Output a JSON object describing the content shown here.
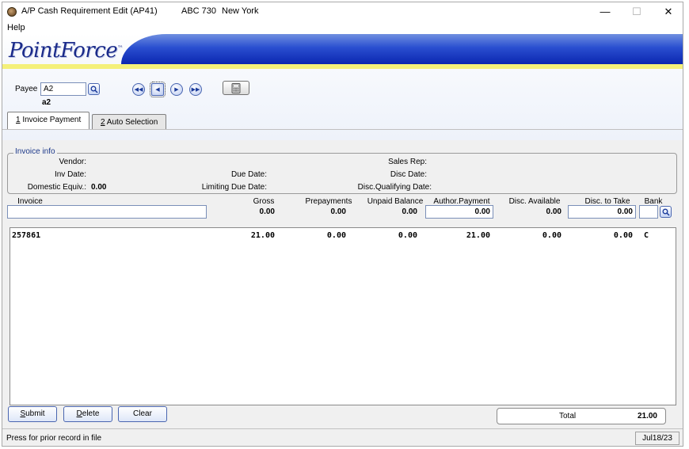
{
  "window": {
    "title": "A/P Cash Requirement Edit (AP41)",
    "company": "ABC 730",
    "city": "New York",
    "controls": {
      "minimize": "—",
      "maximize": "☐",
      "close": "✕"
    }
  },
  "menu": {
    "help": "Help"
  },
  "brand": {
    "logo": "PointForce",
    "tm": "™"
  },
  "payee": {
    "label": "Payee",
    "value": "A2",
    "name": "a2"
  },
  "tabs": [
    {
      "key": "1",
      "label": " Invoice Payment",
      "active": true
    },
    {
      "key": "2",
      "label": " Auto Selection",
      "active": false
    }
  ],
  "invoice_info": {
    "title": "Invoice info",
    "vendor_label": "Vendor:",
    "inv_date_label": "Inv Date:",
    "domestic_equiv_label": "Domestic Equiv.:",
    "domestic_equiv_value": "0.00",
    "due_date_label": "Due Date:",
    "limiting_due_date_label": "Limiting Due Date:",
    "sales_rep_label": "Sales Rep:",
    "disc_date_label": "Disc Date:",
    "disc_qualifying_date_label": "Disc.Qualifying Date:"
  },
  "columns": {
    "invoice": "Invoice",
    "gross": "Gross",
    "prepayments": "Prepayments",
    "unpaid_balance": "Unpaid Balance",
    "author_payment": "Author.Payment",
    "disc_available": "Disc. Available",
    "disc_to_take": "Disc. to Take",
    "bank": "Bank"
  },
  "entry": {
    "invoice": "",
    "gross": "0.00",
    "prepayments": "0.00",
    "unpaid_balance": "0.00",
    "author_payment": "0.00",
    "disc_available": "0.00",
    "disc_to_take": "0.00",
    "bank": ""
  },
  "rows": [
    {
      "invoice": "257861",
      "gross": "21.00",
      "prepayments": "0.00",
      "unpaid_balance": "0.00",
      "author_payment": "21.00",
      "disc_available": "0.00",
      "disc_to_take": "0.00",
      "bank": "C"
    }
  ],
  "buttons": {
    "submit_u": "S",
    "submit_rest": "ubmit",
    "delete_u": "D",
    "delete_rest": "elete",
    "clear": "Clear"
  },
  "total": {
    "label": "Total",
    "value": "21.00"
  },
  "status": {
    "message": "Press for prior record in file",
    "date": "Jul18/23"
  }
}
